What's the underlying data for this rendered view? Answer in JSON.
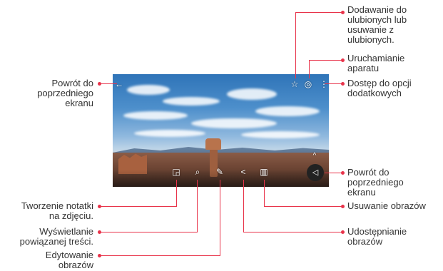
{
  "annotations": {
    "favourite": [
      "Dodawanie do",
      "ulubionych lub",
      "usuwanie z",
      "ulubionych."
    ],
    "camera": [
      "Uruchamianie",
      "aparatu"
    ],
    "more_options": [
      "Dostęp do opcji",
      "dodatkowych"
    ],
    "back_top": [
      "Powrót do",
      "poprzedniego",
      "ekranu"
    ],
    "back_bottom": [
      "Powrót do",
      "poprzedniego",
      "ekranu"
    ],
    "delete": [
      "Usuwanie obrazów"
    ],
    "share": [
      "Udostępnianie",
      "obrazów"
    ],
    "note": [
      "Tworzenie notatki",
      "na zdjęciu."
    ],
    "related": [
      "Wyświetlanie",
      "powiązanej treści."
    ],
    "edit": [
      "Edytowanie",
      "obrazów"
    ]
  },
  "icons": {
    "back": "←",
    "star": "☆",
    "camera": "◎",
    "more": "⋮",
    "chevron_up": "^",
    "note": "◲",
    "related": "⌕",
    "edit": "✎",
    "share": "<",
    "delete": "▥",
    "back_nav": "◁"
  },
  "colors": {
    "leader": "#e8334a"
  }
}
